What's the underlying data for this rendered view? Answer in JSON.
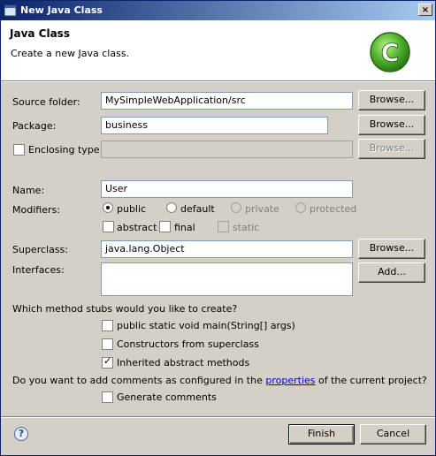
{
  "window": {
    "title": "New Java Class",
    "close_label": "×"
  },
  "header": {
    "title": "Java Class",
    "description": "Create a new Java class.",
    "icon_letter": "C"
  },
  "form": {
    "source_folder": {
      "label": "Source folder:",
      "value": "MySimpleWebApplication/src",
      "button": "Browse..."
    },
    "package": {
      "label": "Package:",
      "value": "business",
      "button": "Browse..."
    },
    "enclosing_type": {
      "label": "Enclosing type:",
      "value": "",
      "button": "Browse...",
      "checked": false
    },
    "name": {
      "label": "Name:",
      "value": "User"
    },
    "modifiers": {
      "label": "Modifiers:",
      "public": "public",
      "default": "default",
      "private": "private",
      "protected": "protected",
      "abstract": "abstract",
      "final": "final",
      "static": "static",
      "selected": "public"
    },
    "superclass": {
      "label": "Superclass:",
      "value": "java.lang.Object",
      "button": "Browse..."
    },
    "interfaces": {
      "label": "Interfaces:",
      "button": "Add..."
    },
    "stubs": {
      "question": "Which method stubs would you like to create?",
      "main": "public static void main(String[] args)",
      "constructors": "Constructors from superclass",
      "inherited": "Inherited abstract methods"
    },
    "comments": {
      "question_before": "Do you want to add comments as configured in the ",
      "link": "properties",
      "question_after": " of the current project?",
      "generate": "Generate comments"
    }
  },
  "footer": {
    "help_label": "?",
    "finish": "Finish",
    "cancel": "Cancel"
  },
  "colors": {
    "title_gradient_start": "#0a246a",
    "title_gradient_end": "#a6caf0",
    "icon_green": "#4caf2a",
    "link": "#0000cc"
  }
}
